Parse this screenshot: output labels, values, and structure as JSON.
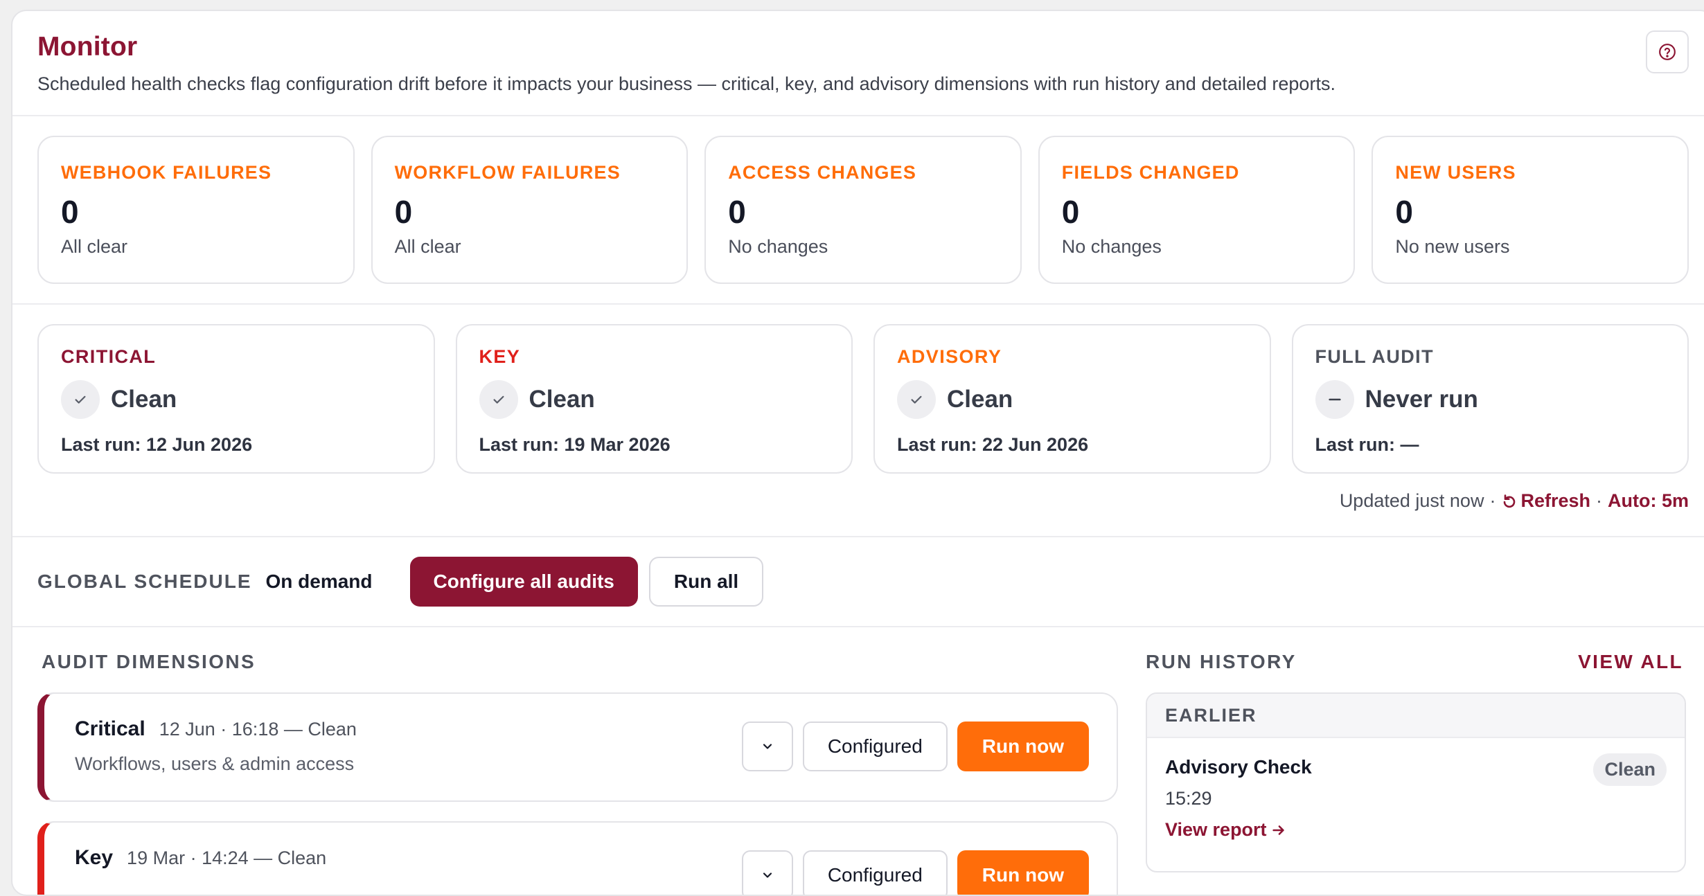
{
  "header": {
    "title": "Monitor",
    "description": "Scheduled health checks flag configuration drift before it impacts your business — critical, key, and advisory dimensions with run history and detailed reports."
  },
  "metrics": [
    {
      "label": "WEBHOOK FAILURES",
      "value": "0",
      "sub": "All clear"
    },
    {
      "label": "WORKFLOW FAILURES",
      "value": "0",
      "sub": "All clear"
    },
    {
      "label": "ACCESS CHANGES",
      "value": "0",
      "sub": "No changes"
    },
    {
      "label": "FIELDS CHANGED",
      "value": "0",
      "sub": "No changes"
    },
    {
      "label": "NEW USERS",
      "value": "0",
      "sub": "No new users"
    }
  ],
  "audits": [
    {
      "label": "CRITICAL",
      "status": "Clean",
      "last_run": "Last run: 12 Jun 2026",
      "color": "#8c1533",
      "icon": "check-icon"
    },
    {
      "label": "KEY",
      "status": "Clean",
      "last_run": "Last run: 19 Mar 2026",
      "color": "#e0201b",
      "icon": "check-icon"
    },
    {
      "label": "ADVISORY",
      "status": "Clean",
      "last_run": "Last run: 22 Jun 2026",
      "color": "#ff6d0a",
      "icon": "check-icon"
    },
    {
      "label": "FULL AUDIT",
      "status": "Never run",
      "last_run": "Last run: —",
      "color": "#4f535d",
      "icon": "dash-icon"
    }
  ],
  "updated": {
    "text": "Updated just now",
    "refresh": "Refresh",
    "auto": "Auto: 5m"
  },
  "schedule": {
    "label": "GLOBAL SCHEDULE",
    "value": "On demand",
    "configure_label": "Configure all audits",
    "run_all_label": "Run all"
  },
  "dimensions": {
    "title": "AUDIT DIMENSIONS",
    "items": [
      {
        "name": "Critical",
        "meta": "12 Jun · 16:18 — Clean",
        "desc": "Workflows, users & admin access",
        "configured_label": "Configured",
        "run_label": "Run now"
      },
      {
        "name": "Key",
        "meta": "19 Mar · 14:24 — Clean",
        "desc": "",
        "configured_label": "Configured",
        "run_label": "Run now"
      }
    ]
  },
  "history": {
    "title": "RUN HISTORY",
    "view_all": "VIEW ALL",
    "group": "EARLIER",
    "items": [
      {
        "name": "Advisory Check",
        "time": "15:29",
        "link": "View report",
        "badge": "Clean"
      }
    ]
  },
  "colors": {
    "brand": "#8c1533",
    "accent": "#ff6d0a",
    "key": "#e0201b"
  }
}
